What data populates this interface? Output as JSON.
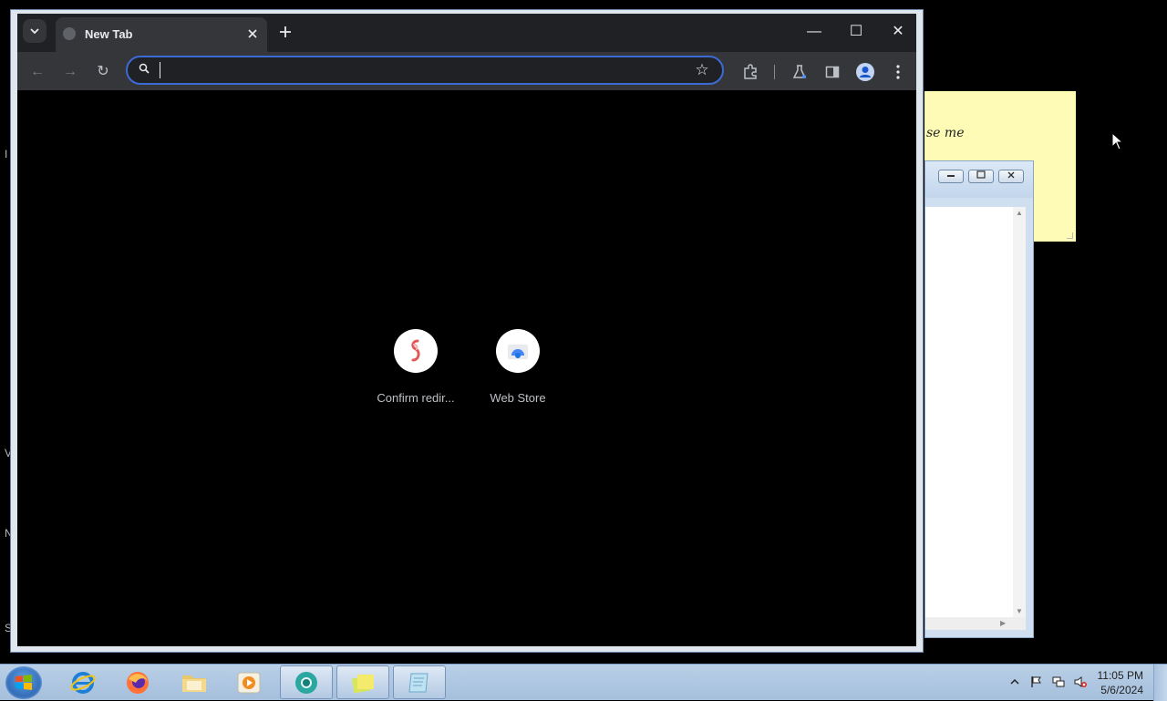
{
  "desktop": {
    "edge_letters": [
      "I",
      "V",
      "N",
      "S"
    ]
  },
  "sticky_note": {
    "text": "se me"
  },
  "background_window": {
    "controls": [
      "minimize",
      "maximize",
      "close"
    ]
  },
  "browser": {
    "tab_search_icon": "chevron-down-icon",
    "tab": {
      "title": "New Tab",
      "favicon": "globe-icon"
    },
    "new_tab_icon": "plus-icon",
    "window_controls": {
      "minimize": "—",
      "maximize": "☐",
      "close": "✕"
    },
    "toolbar": {
      "back": "←",
      "forward": "→",
      "reload": "↻",
      "omnibox": {
        "value": "",
        "placeholder": ""
      },
      "bookmark": "☆",
      "icons": [
        "extensions-icon",
        "labs-flask-icon",
        "side-panel-icon",
        "profile-avatar-icon",
        "kebab-menu-icon"
      ]
    },
    "shortcuts": [
      {
        "label": "Confirm redir...",
        "icon": "red-link-icon"
      },
      {
        "label": "Web Store",
        "icon": "web-store-icon"
      }
    ]
  },
  "taskbar": {
    "apps": [
      "internet-explorer",
      "firefox",
      "file-explorer",
      "media-player",
      "chrome",
      "sticky-notes",
      "notepad"
    ],
    "active_app": "chrome",
    "clock": {
      "time": "11:05 PM",
      "date": "5/6/2024"
    },
    "tray_icons": [
      "show-hidden-icons-arrow",
      "action-center-flag-icon",
      "network-icon",
      "volume-muted-icon"
    ]
  },
  "colors": {
    "chrome_tabstrip": "#202124",
    "chrome_toolbar": "#35363a",
    "omnibox_focus": "#3c6bd6",
    "sticky_yellow": "#fdfbb5",
    "taskbar": "#b9cfe6"
  }
}
